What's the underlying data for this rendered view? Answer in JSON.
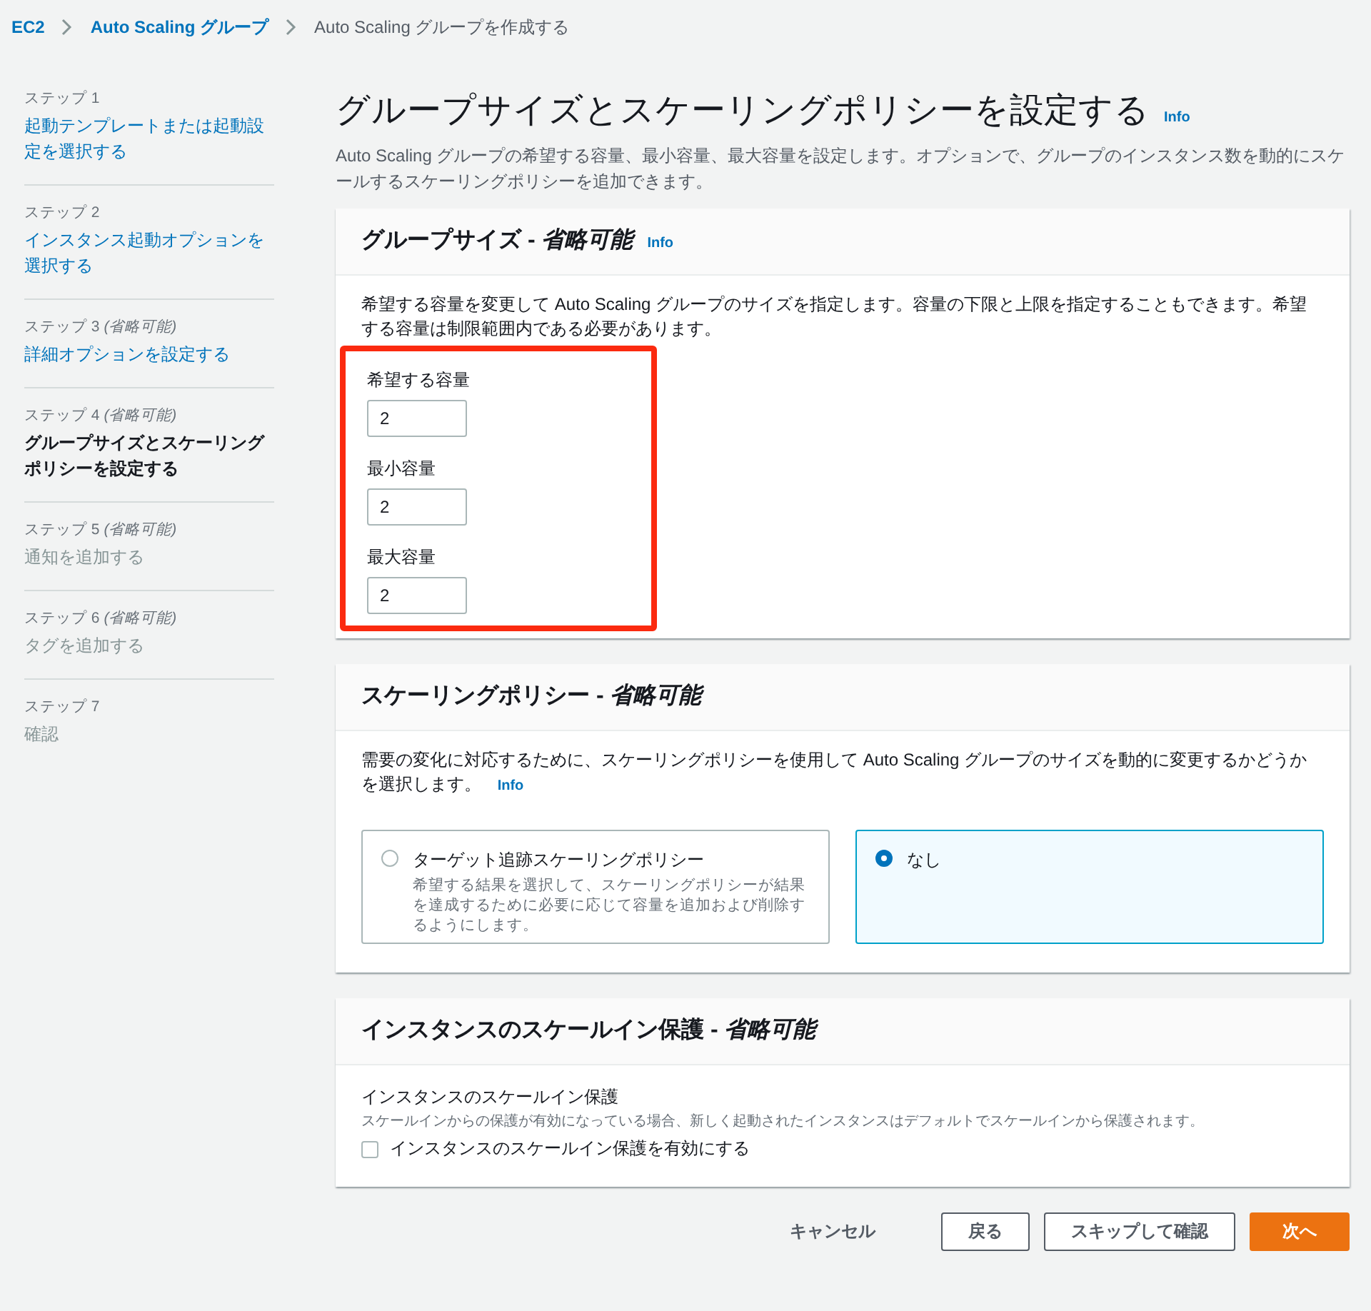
{
  "breadcrumb": [
    {
      "label": "EC2",
      "link": true
    },
    {
      "label": "Auto Scaling グループ",
      "link": true
    },
    {
      "label": "Auto Scaling グループを作成する",
      "link": false
    }
  ],
  "steps": [
    {
      "label": "ステップ 1",
      "title": "起動テンプレートまたは起動設定を選択する",
      "selected": false,
      "disabled": false
    },
    {
      "label": "ステップ 2",
      "title": "インスタンス起動オプションを選択する",
      "selected": false,
      "disabled": false
    },
    {
      "label": "ステップ 3 *(省略可能)*",
      "title": "詳細オプションを設定する",
      "selected": false,
      "disabled": false
    },
    {
      "label": "ステップ 4 *(省略可能)*",
      "title": "グループサイズとスケーリングポリシーを設定する",
      "selected": true,
      "disabled": false
    },
    {
      "label": "ステップ 5 *(省略可能)*",
      "title": "通知を追加する",
      "selected": false,
      "disabled": true
    },
    {
      "label": "ステップ 6 *(省略可能)*",
      "title": "タグを追加する",
      "selected": false,
      "disabled": true
    },
    {
      "label": "ステップ 7",
      "title": "確認",
      "selected": false,
      "disabled": true
    }
  ],
  "page": {
    "title": "グループサイズとスケーリングポリシーを設定する",
    "info": "Info",
    "description": "Auto Scaling グループの希望する容量、最小容量、最大容量を設定します。オプションで、グループのインスタンス数を動的にスケールするスケーリングポリシーを追加できます。"
  },
  "group_size": {
    "heading": "グループサイズ - *省略可能*",
    "info": "Info",
    "description": "希望する容量を変更して Auto Scaling グループのサイズを指定します。容量の下限と上限を指定することもできます。希望する容量は制限範囲内である必要があります。",
    "highlighted": true,
    "fields": [
      {
        "label": "希望する容量",
        "value": "2"
      },
      {
        "label": "最小容量",
        "value": "2"
      },
      {
        "label": "最大容量",
        "value": "2"
      }
    ]
  },
  "scaling_policy": {
    "heading": "スケーリングポリシー - *省略可能*",
    "description": "需要の変化に対応するために、スケーリングポリシーを使用して Auto Scaling グループのサイズを動的に変更するかどうかを選択します。",
    "info": "Info",
    "options": [
      {
        "label": "ターゲット追跡スケーリングポリシー",
        "description": "希望する結果を選択して、スケーリングポリシーが結果を達成するために必要に応じて容量を追加および削除するようにします。",
        "selected": false
      },
      {
        "label": "なし",
        "selected": true
      }
    ]
  },
  "scale_in_protection": {
    "heading": "インスタンスのスケールイン保護 - *省略可能*",
    "label": "インスタンスのスケールイン保護",
    "description": "スケールインからの保護が有効になっている場合、新しく起動されたインスタンスはデフォルトでスケールインから保護されます。",
    "checkbox": {
      "label": "インスタンスのスケールイン保護を有効にする",
      "checked": false
    }
  },
  "buttons": [
    {
      "label": "キャンセル",
      "kind": "link"
    },
    {
      "label": "戻る",
      "kind": "normal"
    },
    {
      "label": "スキップして確認",
      "kind": "normal"
    },
    {
      "label": "次へ",
      "kind": "primary"
    }
  ]
}
